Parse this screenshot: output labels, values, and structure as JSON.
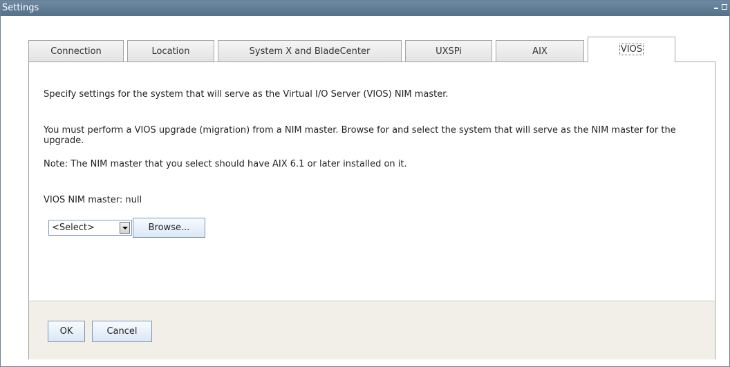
{
  "window": {
    "title": "Settings"
  },
  "tabs": [
    {
      "label": "Connection",
      "active": false
    },
    {
      "label": "Location",
      "active": false
    },
    {
      "label": "System X and BladeCenter",
      "active": false
    },
    {
      "label": "UXSPi",
      "active": false
    },
    {
      "label": "AIX",
      "active": false
    },
    {
      "label": "VIOS",
      "active": true
    }
  ],
  "content": {
    "intro": "Specify settings for the system that will serve as the Virtual I/O Server (VIOS) NIM master.",
    "upgrade_text": "You must perform a VIOS upgrade (migration) from a NIM master. Browse for and select the system that will serve as the NIM master for the upgrade.",
    "note": "Note: The NIM master that you select should have AIX 6.1 or later installed on it.",
    "nim_master_label": "VIOS NIM master: null",
    "select_value": "<Select>",
    "browse_label": "Browse..."
  },
  "footer": {
    "ok_label": "OK",
    "cancel_label": "Cancel"
  },
  "icons": {
    "select_arrow": "chevron-down-icon",
    "minimize": "minimize-icon",
    "maximize": "maximize-icon"
  },
  "colors": {
    "titlebar": "#5f7a93",
    "footer_bg": "#f1efe7",
    "border": "#a3a3a3"
  }
}
